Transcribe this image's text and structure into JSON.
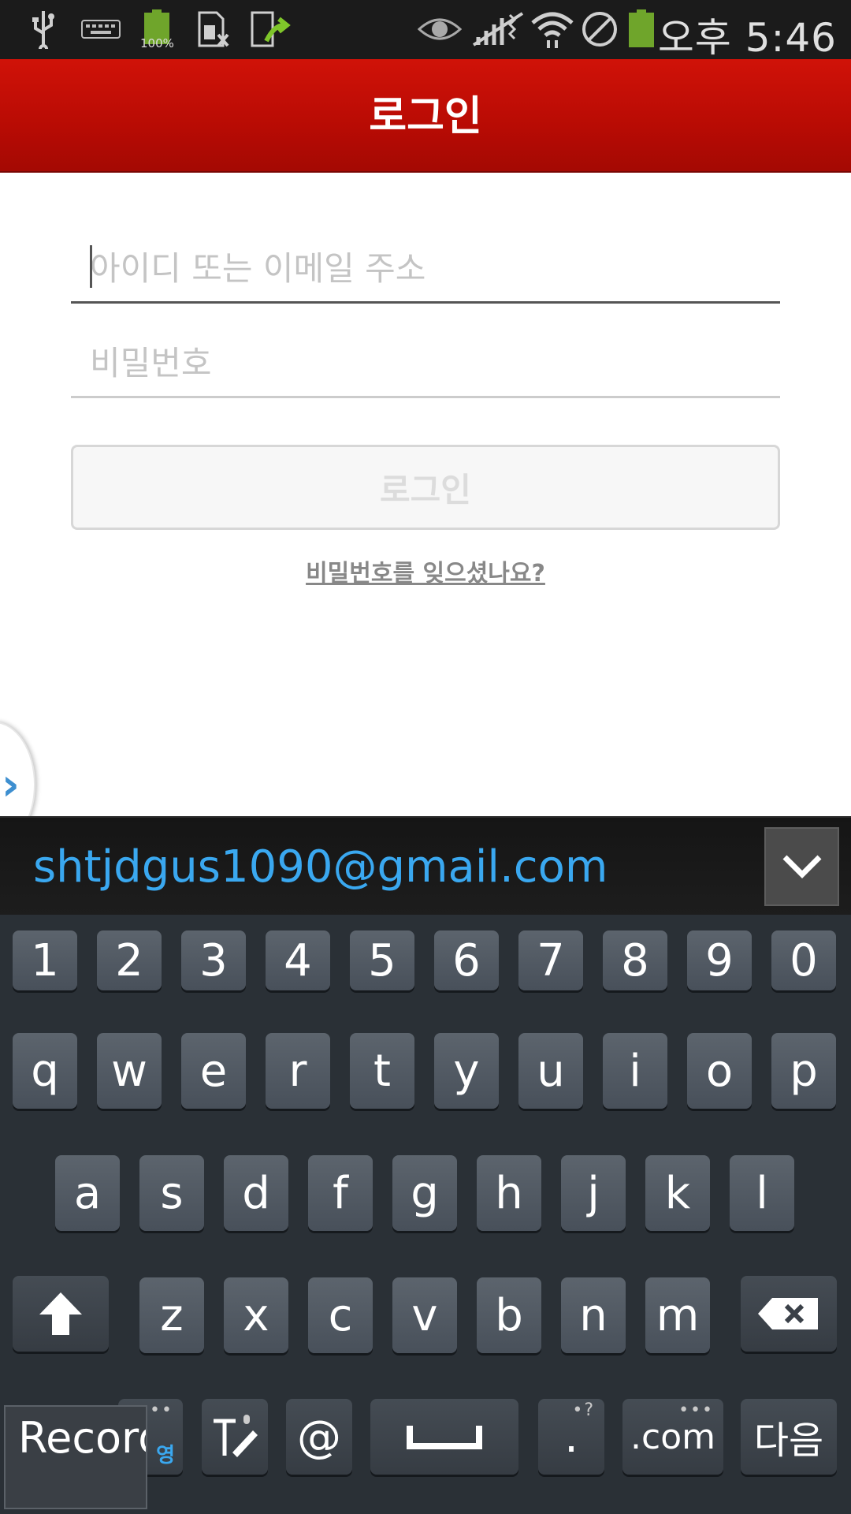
{
  "status_bar": {
    "battery_small_label": "100%",
    "time": "오후 5:46",
    "icons": [
      "usb-icon",
      "keyboard-icon",
      "battery-icon",
      "sim-card-icon",
      "upload-icon",
      "eye-icon",
      "no-signal-icon",
      "wifi-icon",
      "blocked-icon",
      "battery-icon"
    ]
  },
  "title_bar": {
    "title": "로그인"
  },
  "form": {
    "id_placeholder": "아이디 또는 이메일 주소",
    "password_placeholder": "비밀번호",
    "login_label": "로그인",
    "forgot_link": "비밀번호를 잊으셨나요?"
  },
  "side_handle": {
    "glyph": "›"
  },
  "suggestion": {
    "text": "shtjdgus1090@gmail.com",
    "toggle_icon": "chevron-down-icon"
  },
  "keyboard": {
    "row_numbers": [
      "1",
      "2",
      "3",
      "4",
      "5",
      "6",
      "7",
      "8",
      "9",
      "0"
    ],
    "row1": [
      "q",
      "w",
      "e",
      "r",
      "t",
      "y",
      "u",
      "i",
      "o",
      "p"
    ],
    "row2": [
      "a",
      "s",
      "d",
      "f",
      "g",
      "h",
      "j",
      "k",
      "l"
    ],
    "row3": [
      "z",
      "x",
      "c",
      "v",
      "b",
      "n",
      "m"
    ],
    "lang_small": "영",
    "at": "@",
    "period": ".",
    "dotcom": ".com",
    "next": "다음",
    "record_tooltip": "Record"
  },
  "colors": {
    "title_bar": "#c00e06",
    "suggestion_text": "#3aa8f0",
    "keyboard_bg": "#2a3036"
  }
}
